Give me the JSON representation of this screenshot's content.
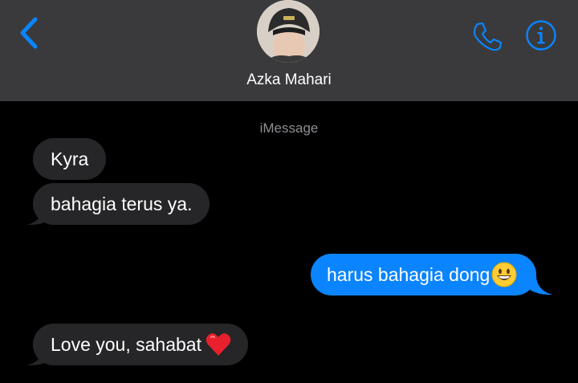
{
  "header": {
    "contact_name": "Azka Mahari",
    "back_icon": "chevron-left-icon",
    "call_icon": "phone-icon",
    "info_icon": "info-icon",
    "accent_color": "#0a84ff",
    "background_color": "#3a3a3c"
  },
  "thread": {
    "service_label": "iMessage",
    "messages": [
      {
        "direction": "incoming",
        "text": "Kyra"
      },
      {
        "direction": "incoming",
        "text": "bahagia terus ya."
      },
      {
        "direction": "outgoing",
        "text": "harus bahagia dong",
        "emoji": "grinning-face"
      },
      {
        "direction": "incoming",
        "text": "Love you, sahabat",
        "emoji": "red-heart"
      }
    ],
    "incoming_color": "#262628",
    "outgoing_color": "#0a84ff"
  }
}
